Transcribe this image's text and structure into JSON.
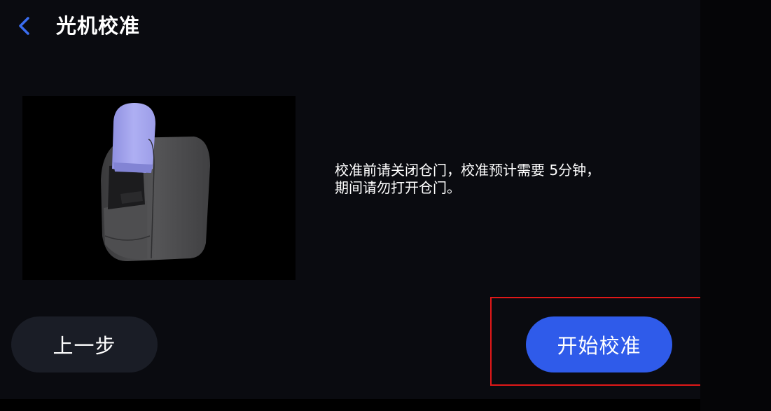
{
  "header": {
    "back_icon": "chevron-left-icon",
    "title": "光机校准"
  },
  "illustration": {
    "subject": "printer-illustration"
  },
  "instruction": {
    "line1": "校准前请关闭仓门，校准预计需要 5分钟，",
    "line2": "期间请勿打开仓门。"
  },
  "buttons": {
    "prev_label": "上一步",
    "start_label": "开始校准"
  },
  "colors": {
    "accent": "#2f5bea",
    "back_icon": "#3a6df0",
    "secondary_button": "#1a1d26",
    "background": "#0a0b10",
    "highlight": "#e01818",
    "lid": "#a9aaf0",
    "body": "#4a4a4c"
  }
}
